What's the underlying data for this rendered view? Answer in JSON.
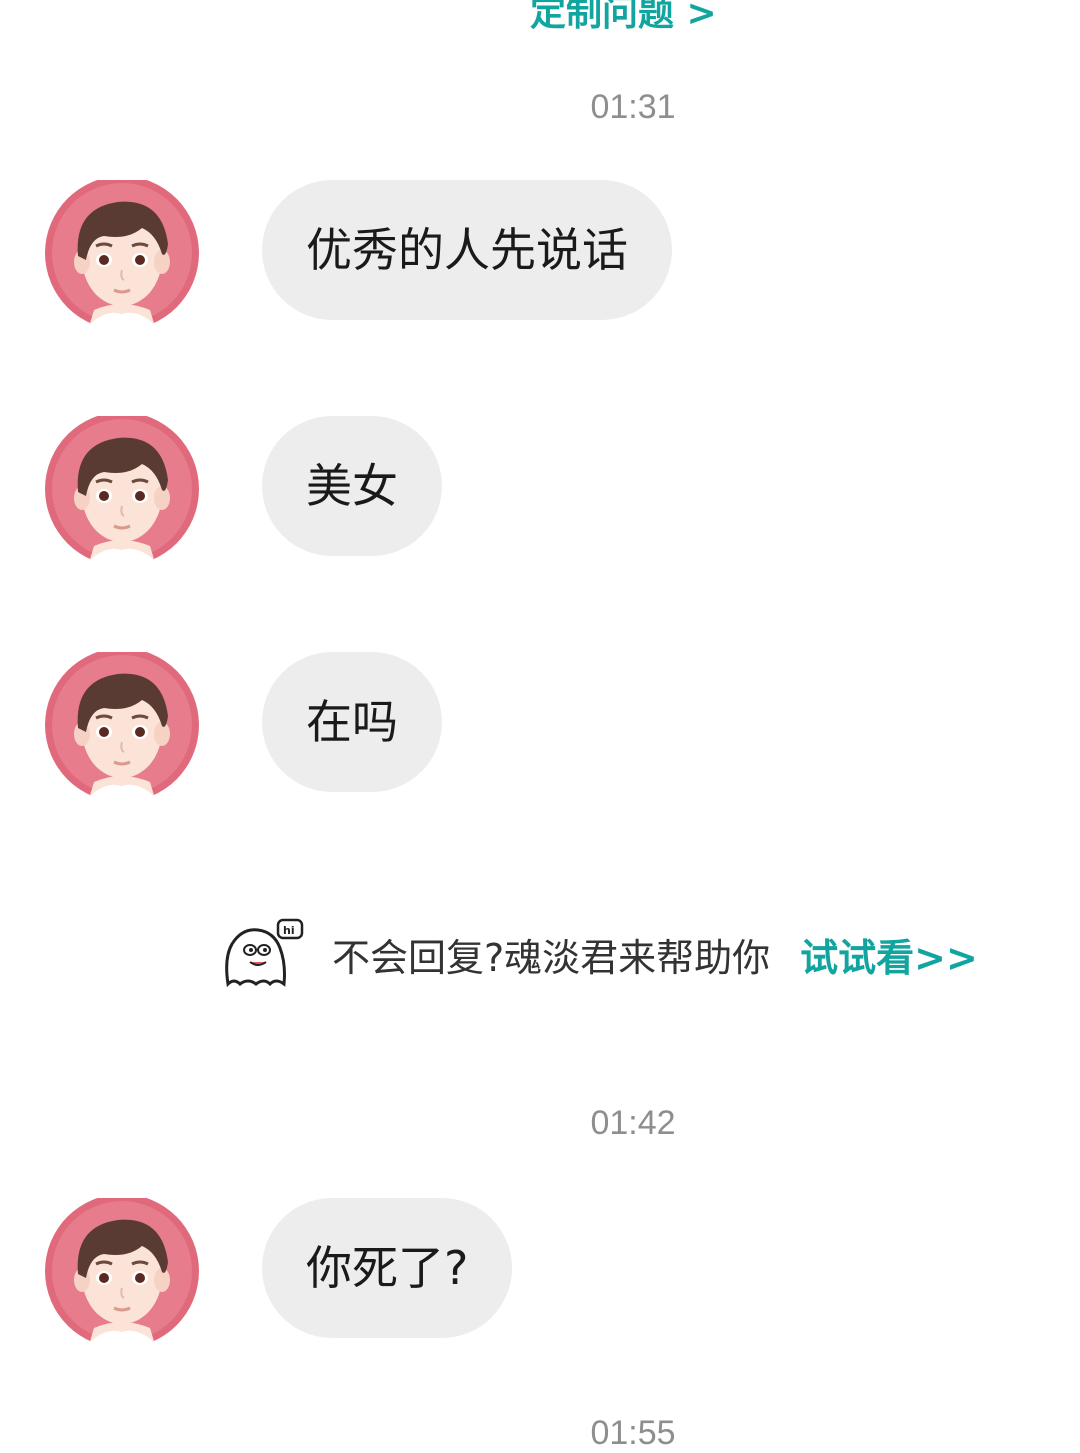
{
  "header": {
    "top_link": "定制问题 >"
  },
  "timestamps": [
    "01:31",
    "01:42",
    "01:55"
  ],
  "messages": [
    {
      "text": "优秀的人先说话"
    },
    {
      "text": "美女"
    },
    {
      "text": "在吗"
    },
    {
      "text": "你死了?"
    }
  ],
  "hint": {
    "icon": "ghost-hi-icon",
    "text": "不会回复?魂淡君来帮助你",
    "link": "试试看>>"
  },
  "colors": {
    "accent": "#12a5a0",
    "bubble": "#ededed",
    "avatar_bg": "#e06a7c",
    "timestamp": "#8e8e8e"
  }
}
